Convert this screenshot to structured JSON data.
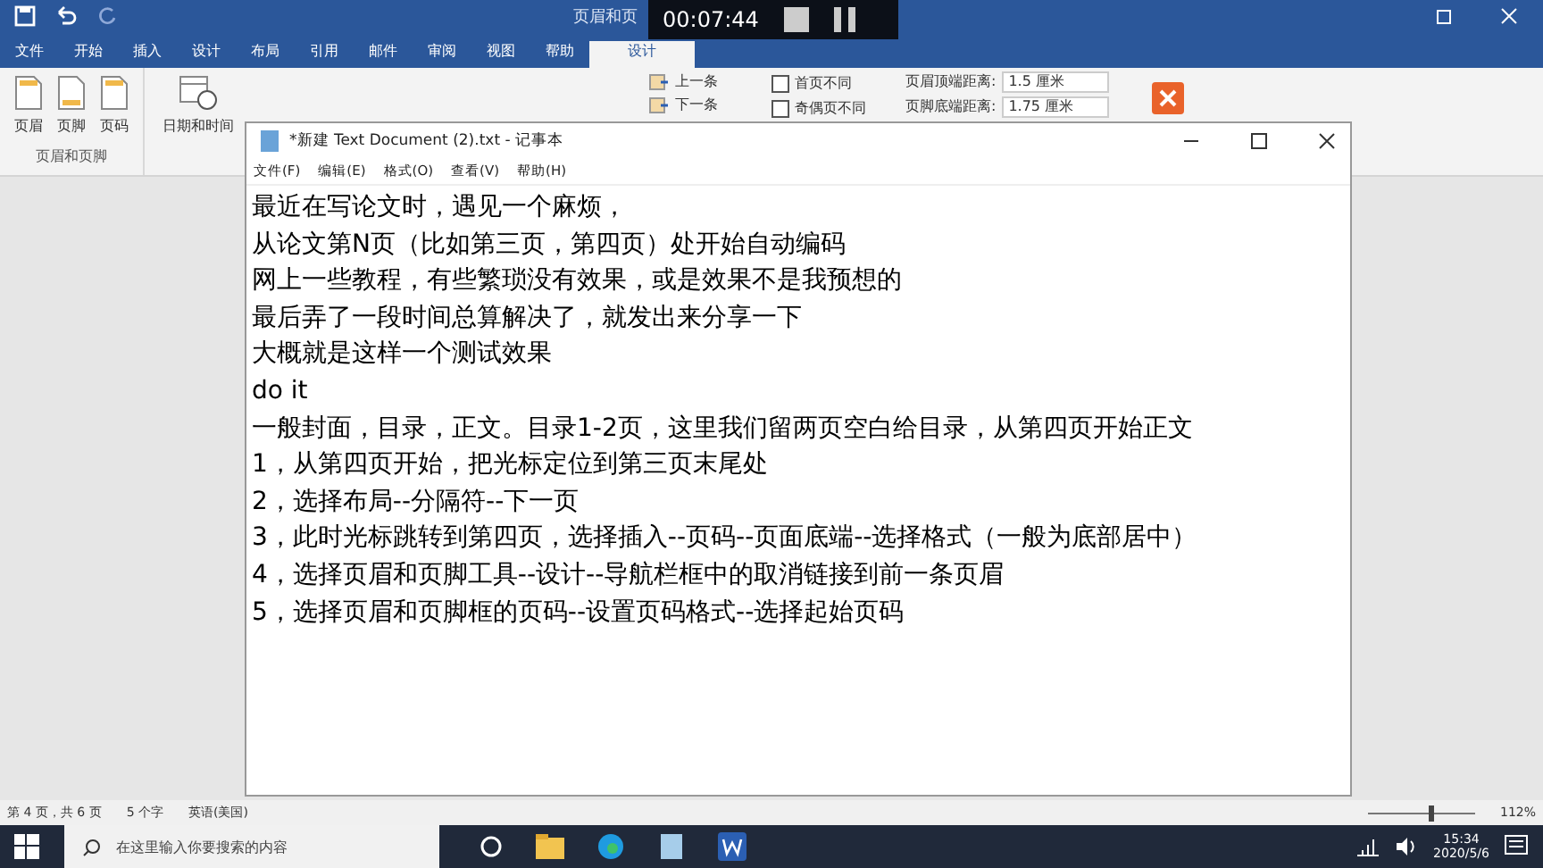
{
  "word": {
    "context_title": "页眉和页",
    "tabs": [
      {
        "label": "文件",
        "selected": false
      },
      {
        "label": "开始",
        "selected": false
      },
      {
        "label": "插入",
        "selected": false
      },
      {
        "label": "设计",
        "selected": false
      },
      {
        "label": "布局",
        "selected": false
      },
      {
        "label": "引用",
        "selected": false
      },
      {
        "label": "邮件",
        "selected": false
      },
      {
        "label": "审阅",
        "selected": false
      },
      {
        "label": "视图",
        "selected": false
      },
      {
        "label": "帮助",
        "selected": false
      },
      {
        "label": "设计",
        "selected": true
      }
    ],
    "ribbon": {
      "hf_buttons": [
        "页眉",
        "页脚",
        "页码"
      ],
      "hf_group": "页眉和页脚",
      "date_button": "日期和时间",
      "nav": [
        "上一条",
        "下一条"
      ],
      "options": [
        {
          "label": "首页不同",
          "checked": false
        },
        {
          "label": "奇偶页不同",
          "checked": false
        }
      ],
      "positions": [
        {
          "label": "页眉顶端距离:",
          "value": "1.5 厘米"
        },
        {
          "label": "页脚底端距离:",
          "value": "1.75 厘米"
        }
      ]
    },
    "status": {
      "page": "第 4 页，共 6 页",
      "words": "5 个字",
      "language": "英语(美国)",
      "zoom": "112%",
      "zoom_slider": {
        "level": 0.6
      }
    }
  },
  "recorder": {
    "time": "00:07:44"
  },
  "notepad": {
    "title": "*新建 Text Document (2).txt - 记事本",
    "menu": [
      "文件(F)",
      "编辑(E)",
      "格式(O)",
      "查看(V)",
      "帮助(H)"
    ],
    "lines": [
      "最近在写论文时，遇见一个麻烦，",
      "从论文第N页（比如第三页，第四页）处开始自动编码",
      "网上一些教程，有些繁琐没有效果，或是效果不是我预想的",
      "最后弄了一段时间总算解决了，就发出来分享一下",
      "大概就是这样一个测试效果",
      "do it",
      "一般封面，目录，正文。目录1-2页，这里我们留两页空白给目录，从第四页开始正文",
      "1，从第四页开始，把光标定位到第三页末尾处",
      "2，选择布局--分隔符--下一页",
      "3，此时光标跳转到第四页，选择插入--页码--页面底端--选择格式（一般为底部居中）",
      "4，选择页眉和页脚工具--设计--导航栏框中的取消链接到前一条页眉",
      "5，选择页眉和页脚框的页码--设置页码格式--选择起始页码"
    ]
  },
  "taskbar": {
    "search_placeholder": "在这里输入你要搜索的内容",
    "time": "15:34",
    "date": "2020/5/6"
  }
}
